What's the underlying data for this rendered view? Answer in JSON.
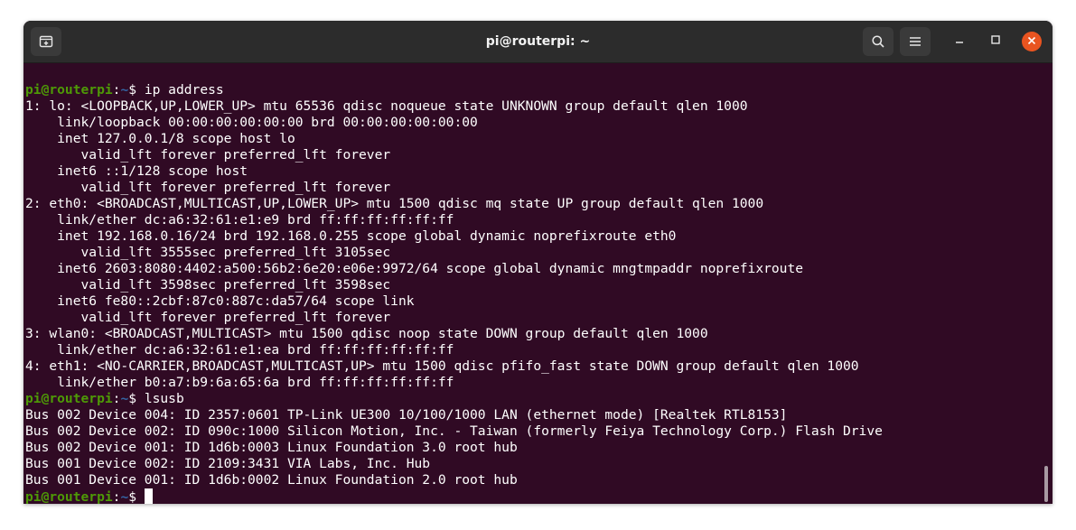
{
  "window": {
    "title": "pi@routerpi: ~"
  },
  "header_buttons": {
    "new_tab_icon": "new-tab-icon",
    "search_icon": "search-icon",
    "menu_icon": "hamburger-menu-icon",
    "minimize_icon": "minimize-icon",
    "maximize_icon": "maximize-icon",
    "close_icon": "close-icon"
  },
  "colors": {
    "terminal_bg": "#300a24",
    "prompt_user": "#4e9a06",
    "prompt_path": "#3465a4",
    "close_button": "#e95420",
    "text": "#ffffff"
  },
  "prompt": {
    "user_host": "pi@routerpi",
    "separator": ":",
    "path": "~",
    "symbol": "$ "
  },
  "terminal_lines": [
    {
      "type": "prompt",
      "command": "ip address"
    },
    {
      "type": "output",
      "text": "1: lo: <LOOPBACK,UP,LOWER_UP> mtu 65536 qdisc noqueue state UNKNOWN group default qlen 1000"
    },
    {
      "type": "output",
      "text": "    link/loopback 00:00:00:00:00:00 brd 00:00:00:00:00:00"
    },
    {
      "type": "output",
      "text": "    inet 127.0.0.1/8 scope host lo"
    },
    {
      "type": "output",
      "text": "       valid_lft forever preferred_lft forever"
    },
    {
      "type": "output",
      "text": "    inet6 ::1/128 scope host"
    },
    {
      "type": "output",
      "text": "       valid_lft forever preferred_lft forever"
    },
    {
      "type": "output",
      "text": "2: eth0: <BROADCAST,MULTICAST,UP,LOWER_UP> mtu 1500 qdisc mq state UP group default qlen 1000"
    },
    {
      "type": "output",
      "text": "    link/ether dc:a6:32:61:e1:e9 brd ff:ff:ff:ff:ff:ff"
    },
    {
      "type": "output",
      "text": "    inet 192.168.0.16/24 brd 192.168.0.255 scope global dynamic noprefixroute eth0"
    },
    {
      "type": "output",
      "text": "       valid_lft 3555sec preferred_lft 3105sec"
    },
    {
      "type": "output",
      "text": "    inet6 2603:8080:4402:a500:56b2:6e20:e06e:9972/64 scope global dynamic mngtmpaddr noprefixroute"
    },
    {
      "type": "output",
      "text": "       valid_lft 3598sec preferred_lft 3598sec"
    },
    {
      "type": "output",
      "text": "    inet6 fe80::2cbf:87c0:887c:da57/64 scope link"
    },
    {
      "type": "output",
      "text": "       valid_lft forever preferred_lft forever"
    },
    {
      "type": "output",
      "text": "3: wlan0: <BROADCAST,MULTICAST> mtu 1500 qdisc noop state DOWN group default qlen 1000"
    },
    {
      "type": "output",
      "text": "    link/ether dc:a6:32:61:e1:ea brd ff:ff:ff:ff:ff:ff"
    },
    {
      "type": "output",
      "text": "4: eth1: <NO-CARRIER,BROADCAST,MULTICAST,UP> mtu 1500 qdisc pfifo_fast state DOWN group default qlen 1000"
    },
    {
      "type": "output",
      "text": "    link/ether b0:a7:b9:6a:65:6a brd ff:ff:ff:ff:ff:ff"
    },
    {
      "type": "prompt",
      "command": "lsusb"
    },
    {
      "type": "output",
      "text": "Bus 002 Device 004: ID 2357:0601 TP-Link UE300 10/100/1000 LAN (ethernet mode) [Realtek RTL8153]"
    },
    {
      "type": "output",
      "text": "Bus 002 Device 002: ID 090c:1000 Silicon Motion, Inc. - Taiwan (formerly Feiya Technology Corp.) Flash Drive"
    },
    {
      "type": "output",
      "text": "Bus 002 Device 001: ID 1d6b:0003 Linux Foundation 3.0 root hub"
    },
    {
      "type": "output",
      "text": "Bus 001 Device 002: ID 2109:3431 VIA Labs, Inc. Hub"
    },
    {
      "type": "output",
      "text": "Bus 001 Device 001: ID 1d6b:0002 Linux Foundation 2.0 root hub"
    },
    {
      "type": "prompt",
      "command": "",
      "cursor": true
    }
  ]
}
